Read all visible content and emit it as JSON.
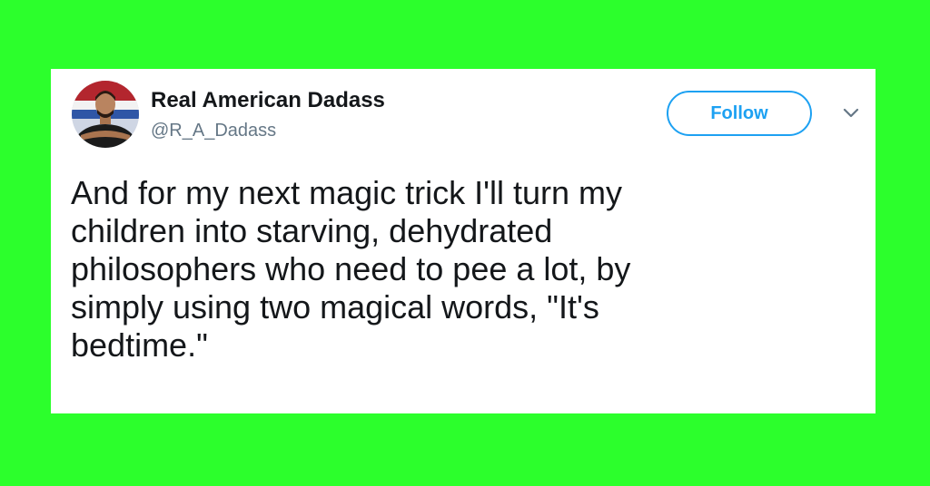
{
  "background_color": "#2cff2c",
  "accent_color": "#1da1f2",
  "tweet": {
    "author": {
      "display_name": "Real American Dadass",
      "handle": "@R_A_Dadass",
      "avatar_icon": "user-avatar-photo"
    },
    "follow_label": "Follow",
    "menu_icon": "chevron-down-icon",
    "text": "And for my next magic trick I'll turn my\nchildren into starving, dehydrated\nphilosophers who need to pee a lot, by\nsimply using two magical words, \"It's\nbedtime.\""
  }
}
